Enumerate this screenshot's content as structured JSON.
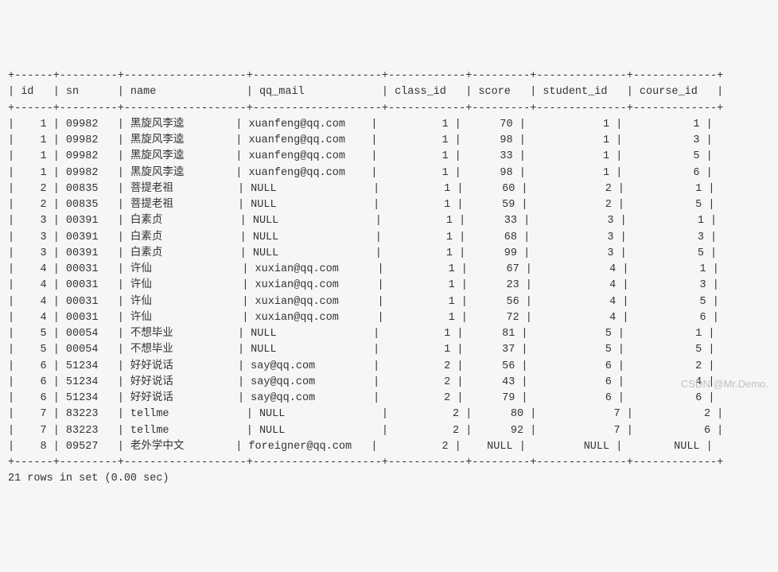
{
  "columns": [
    "id",
    "sn",
    "name",
    "qq_mail",
    "class_id",
    "score",
    "student_id",
    "course_id"
  ],
  "widths": [
    4,
    7,
    17,
    18,
    10,
    7,
    12,
    11
  ],
  "align": [
    "r",
    "l",
    "l",
    "l",
    "r",
    "r",
    "r",
    "r"
  ],
  "cjk_cols": [
    2
  ],
  "rows": [
    [
      "1",
      "09982",
      "黑旋风李逵",
      "xuanfeng@qq.com",
      "1",
      "70",
      "1",
      "1"
    ],
    [
      "1",
      "09982",
      "黑旋风李逵",
      "xuanfeng@qq.com",
      "1",
      "98",
      "1",
      "3"
    ],
    [
      "1",
      "09982",
      "黑旋风李逵",
      "xuanfeng@qq.com",
      "1",
      "33",
      "1",
      "5"
    ],
    [
      "1",
      "09982",
      "黑旋风李逵",
      "xuanfeng@qq.com",
      "1",
      "98",
      "1",
      "6"
    ],
    [
      "2",
      "00835",
      "菩提老祖",
      "NULL",
      "1",
      "60",
      "2",
      "1"
    ],
    [
      "2",
      "00835",
      "菩提老祖",
      "NULL",
      "1",
      "59",
      "2",
      "5"
    ],
    [
      "3",
      "00391",
      "白素贞",
      "NULL",
      "1",
      "33",
      "3",
      "1"
    ],
    [
      "3",
      "00391",
      "白素贞",
      "NULL",
      "1",
      "68",
      "3",
      "3"
    ],
    [
      "3",
      "00391",
      "白素贞",
      "NULL",
      "1",
      "99",
      "3",
      "5"
    ],
    [
      "4",
      "00031",
      "许仙",
      "xuxian@qq.com",
      "1",
      "67",
      "4",
      "1"
    ],
    [
      "4",
      "00031",
      "许仙",
      "xuxian@qq.com",
      "1",
      "23",
      "4",
      "3"
    ],
    [
      "4",
      "00031",
      "许仙",
      "xuxian@qq.com",
      "1",
      "56",
      "4",
      "5"
    ],
    [
      "4",
      "00031",
      "许仙",
      "xuxian@qq.com",
      "1",
      "72",
      "4",
      "6"
    ],
    [
      "5",
      "00054",
      "不想毕业",
      "NULL",
      "1",
      "81",
      "5",
      "1"
    ],
    [
      "5",
      "00054",
      "不想毕业",
      "NULL",
      "1",
      "37",
      "5",
      "5"
    ],
    [
      "6",
      "51234",
      "好好说话",
      "say@qq.com",
      "2",
      "56",
      "6",
      "2"
    ],
    [
      "6",
      "51234",
      "好好说话",
      "say@qq.com",
      "2",
      "43",
      "6",
      "4"
    ],
    [
      "6",
      "51234",
      "好好说话",
      "say@qq.com",
      "2",
      "79",
      "6",
      "6"
    ],
    [
      "7",
      "83223",
      "tellme",
      "NULL",
      "2",
      "80",
      "7",
      "2"
    ],
    [
      "7",
      "83223",
      "tellme",
      "NULL",
      "2",
      "92",
      "7",
      "6"
    ],
    [
      "8",
      "09527",
      "老外学中文",
      "foreigner@qq.com",
      "2",
      "NULL",
      "NULL",
      "NULL"
    ]
  ],
  "footer": "21 rows in set (0.00 sec)",
  "watermark": "CSDN @Mr.Demo."
}
